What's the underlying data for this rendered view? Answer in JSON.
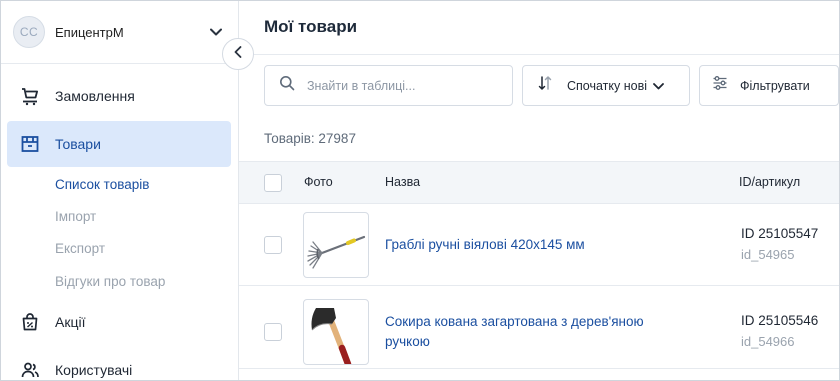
{
  "account": {
    "avatar_initials": "CC",
    "name": "ЕпицентрМ"
  },
  "sidebar": {
    "items": [
      {
        "label": "Замовлення",
        "icon": "cart-icon"
      },
      {
        "label": "Товари",
        "icon": "box-icon"
      },
      {
        "label": "Акції",
        "icon": "promo-bag-icon"
      },
      {
        "label": "Користувачі",
        "icon": "users-icon"
      }
    ],
    "subitems": [
      {
        "label": "Список товарів"
      },
      {
        "label": "Імпорт"
      },
      {
        "label": "Експорт"
      },
      {
        "label": "Відгуки про товар"
      }
    ]
  },
  "main": {
    "title": "Мої товари",
    "search": {
      "placeholder": "Знайти в таблиці..."
    },
    "sort": {
      "label": "Спочатку нові"
    },
    "filter": {
      "label": "Фільтрувати"
    },
    "count_text": "Товарів: 27987",
    "table": {
      "headers": {
        "photo": "Фото",
        "name": "Назва",
        "id": "ID/артикул"
      },
      "rows": [
        {
          "name": "Граблі ручні віялові 420х145 мм",
          "id": "ID 25105547",
          "article": "id_54965"
        },
        {
          "name": "Сокира кована загартована з дерев'яною ручкою",
          "id": "ID 25105546",
          "article": "id_54966"
        }
      ]
    }
  },
  "colors": {
    "accent": "#1b4fa0",
    "active_bg": "#dbe8fb",
    "header_bg": "#f3f6f9"
  }
}
